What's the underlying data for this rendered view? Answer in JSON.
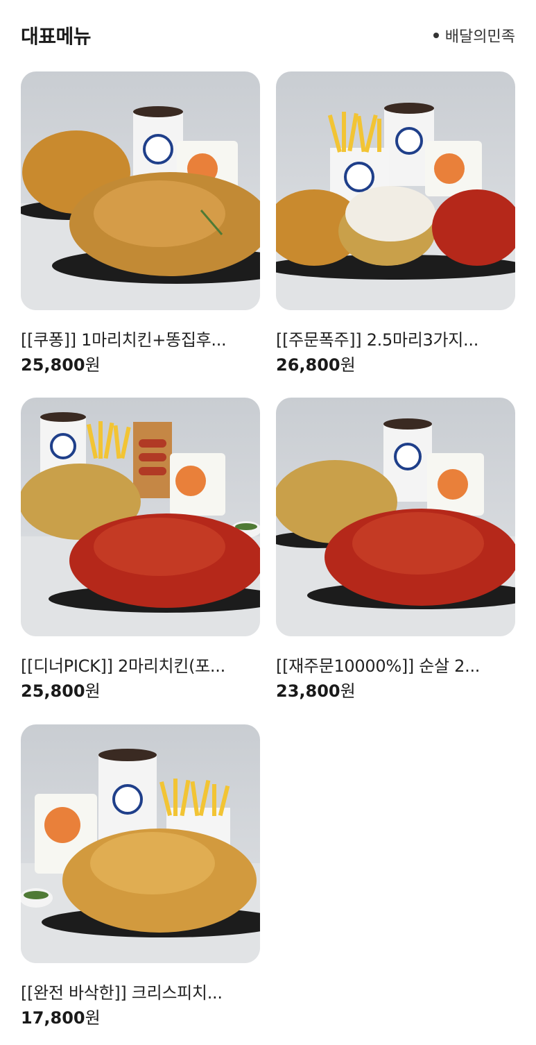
{
  "header": {
    "title": "대표메뉴",
    "source": "배달의민족"
  },
  "menu": [
    {
      "name": "[[쿠퐁]] 1마리치킨+똥집후...",
      "price": "25,800",
      "currency": "원"
    },
    {
      "name": "[[주문폭주]] 2.5마리3가지...",
      "price": "26,800",
      "currency": "원"
    },
    {
      "name": "[[디너PICK]] 2마리치킨(포...",
      "price": "25,800",
      "currency": "원"
    },
    {
      "name": "[[재주문10000%]] 순살 2...",
      "price": "23,800",
      "currency": "원"
    },
    {
      "name": "[[완전 바삭한]] 크리스피치...",
      "price": "17,800",
      "currency": "원"
    }
  ],
  "colors": {
    "fried": "#c98a2e",
    "fried_light": "#dba54a",
    "sauced": "#b5281a",
    "plate": "#1c1c1c",
    "backdrop": "#cdd0d4"
  }
}
